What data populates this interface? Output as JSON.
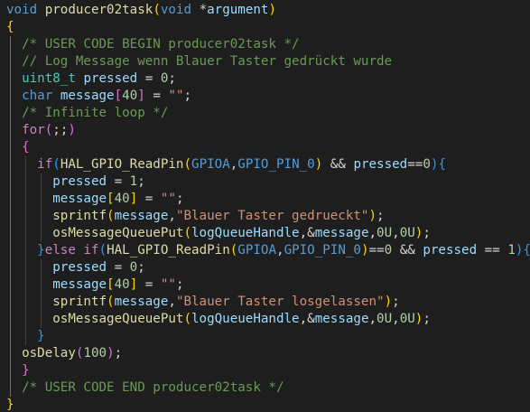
{
  "editor": {
    "language": "c",
    "colors": {
      "background": "#1e1e1e",
      "keyword": "#569cd6",
      "control": "#c586c0",
      "function": "#dcdcaa",
      "type": "#4ec9b0",
      "variable": "#9cdcfe",
      "string": "#ce9178",
      "number": "#b5cea8",
      "comment": "#6a9955",
      "text": "#d4d4d4",
      "bracket_level_1": "#ffd700",
      "bracket_level_2": "#da70d6",
      "bracket_level_3": "#179fff"
    },
    "lines": [
      [
        [
          "keyword",
          "void"
        ],
        [
          "plain",
          " "
        ],
        [
          "function",
          "producer02task"
        ],
        [
          "brace-y",
          "("
        ],
        [
          "keyword",
          "void"
        ],
        [
          "plain",
          " *"
        ],
        [
          "variable",
          "argument"
        ],
        [
          "brace-y",
          ")"
        ]
      ],
      [
        [
          "brace-y",
          "{"
        ]
      ],
      [
        [
          "plain",
          "  "
        ],
        [
          "comment",
          "/* USER CODE BEGIN producer02task */"
        ]
      ],
      [
        [
          "plain",
          "  "
        ],
        [
          "comment",
          "// Log Message wenn Blauer Taster gedrückt wurde"
        ]
      ],
      [
        [
          "plain",
          "  "
        ],
        [
          "type",
          "uint8_t"
        ],
        [
          "plain",
          " "
        ],
        [
          "variable",
          "pressed"
        ],
        [
          "plain",
          " = "
        ],
        [
          "number",
          "0"
        ],
        [
          "plain",
          ";"
        ]
      ],
      [
        [
          "plain",
          "  "
        ],
        [
          "keyword",
          "char"
        ],
        [
          "plain",
          " "
        ],
        [
          "variable",
          "message"
        ],
        [
          "brace-p",
          "["
        ],
        [
          "number",
          "40"
        ],
        [
          "brace-p",
          "]"
        ],
        [
          "plain",
          " = "
        ],
        [
          "string",
          "\"\""
        ],
        [
          "plain",
          ";"
        ]
      ],
      [
        [
          "plain",
          "  "
        ],
        [
          "comment",
          "/* Infinite loop */"
        ]
      ],
      [
        [
          "plain",
          "  "
        ],
        [
          "control",
          "for"
        ],
        [
          "brace-p",
          "("
        ],
        [
          "plain",
          ";;"
        ],
        [
          "brace-p",
          ")"
        ]
      ],
      [
        [
          "plain",
          "  "
        ],
        [
          "brace-p",
          "{"
        ]
      ],
      [
        [
          "plain",
          "    "
        ],
        [
          "control",
          "if"
        ],
        [
          "brace-b",
          "("
        ],
        [
          "function",
          "HAL_GPIO_ReadPin"
        ],
        [
          "brace-y",
          "("
        ],
        [
          "macro",
          "GPIOA"
        ],
        [
          "plain",
          ","
        ],
        [
          "macro",
          "GPIO_PIN_0"
        ],
        [
          "brace-y",
          ")"
        ],
        [
          "plain",
          " && "
        ],
        [
          "variable",
          "pressed"
        ],
        [
          "plain",
          "=="
        ],
        [
          "number",
          "0"
        ],
        [
          "brace-b",
          ")"
        ],
        [
          "brace-b",
          "{"
        ]
      ],
      [
        [
          "plain",
          "      "
        ],
        [
          "variable",
          "pressed"
        ],
        [
          "plain",
          " = "
        ],
        [
          "number",
          "1"
        ],
        [
          "plain",
          ";"
        ]
      ],
      [
        [
          "plain",
          "      "
        ],
        [
          "variable",
          "message"
        ],
        [
          "brace-y",
          "["
        ],
        [
          "number",
          "40"
        ],
        [
          "brace-y",
          "]"
        ],
        [
          "plain",
          " = "
        ],
        [
          "string",
          "\"\""
        ],
        [
          "plain",
          ";"
        ]
      ],
      [
        [
          "plain",
          "      "
        ],
        [
          "function",
          "sprintf"
        ],
        [
          "brace-y",
          "("
        ],
        [
          "variable",
          "message"
        ],
        [
          "plain",
          ","
        ],
        [
          "string",
          "\"Blauer Taster gedrueckt\""
        ],
        [
          "brace-y",
          ")"
        ],
        [
          "plain",
          ";"
        ]
      ],
      [
        [
          "plain",
          "      "
        ],
        [
          "function",
          "osMessageQueuePut"
        ],
        [
          "brace-y",
          "("
        ],
        [
          "variable",
          "logQueueHandle"
        ],
        [
          "plain",
          ",&"
        ],
        [
          "variable",
          "message"
        ],
        [
          "plain",
          ","
        ],
        [
          "number",
          "0U"
        ],
        [
          "plain",
          ","
        ],
        [
          "number",
          "0U"
        ],
        [
          "brace-y",
          ")"
        ],
        [
          "plain",
          ";"
        ]
      ],
      [
        [
          "plain",
          "    "
        ],
        [
          "brace-b",
          "}"
        ],
        [
          "control",
          "else"
        ],
        [
          "plain",
          " "
        ],
        [
          "control",
          "if"
        ],
        [
          "brace-b",
          "("
        ],
        [
          "function",
          "HAL_GPIO_ReadPin"
        ],
        [
          "brace-y",
          "("
        ],
        [
          "macro",
          "GPIOA"
        ],
        [
          "plain",
          ","
        ],
        [
          "macro",
          "GPIO_PIN_0"
        ],
        [
          "brace-y",
          ")"
        ],
        [
          "plain",
          "=="
        ],
        [
          "number",
          "0"
        ],
        [
          "plain",
          " && "
        ],
        [
          "variable",
          "pressed"
        ],
        [
          "plain",
          " == "
        ],
        [
          "number",
          "1"
        ],
        [
          "brace-b",
          ")"
        ],
        [
          "brace-b",
          "{"
        ]
      ],
      [
        [
          "plain",
          "      "
        ],
        [
          "variable",
          "pressed"
        ],
        [
          "plain",
          " = "
        ],
        [
          "number",
          "0"
        ],
        [
          "plain",
          ";"
        ]
      ],
      [
        [
          "plain",
          "      "
        ],
        [
          "variable",
          "message"
        ],
        [
          "brace-y",
          "["
        ],
        [
          "number",
          "40"
        ],
        [
          "brace-y",
          "]"
        ],
        [
          "plain",
          " = "
        ],
        [
          "string",
          "\"\""
        ],
        [
          "plain",
          ";"
        ]
      ],
      [
        [
          "plain",
          "      "
        ],
        [
          "function",
          "sprintf"
        ],
        [
          "brace-y",
          "("
        ],
        [
          "variable",
          "message"
        ],
        [
          "plain",
          ","
        ],
        [
          "string",
          "\"Blauer Taster losgelassen\""
        ],
        [
          "brace-y",
          ")"
        ],
        [
          "plain",
          ";"
        ]
      ],
      [
        [
          "plain",
          "      "
        ],
        [
          "function",
          "osMessageQueuePut"
        ],
        [
          "brace-y",
          "("
        ],
        [
          "variable",
          "logQueueHandle"
        ],
        [
          "plain",
          ",&"
        ],
        [
          "variable",
          "message"
        ],
        [
          "plain",
          ","
        ],
        [
          "number",
          "0U"
        ],
        [
          "plain",
          ","
        ],
        [
          "number",
          "0U"
        ],
        [
          "brace-y",
          ")"
        ],
        [
          "plain",
          ";"
        ]
      ],
      [
        [
          "plain",
          "    "
        ],
        [
          "brace-b",
          "}"
        ]
      ],
      [
        [
          "plain",
          "  "
        ],
        [
          "function",
          "osDelay"
        ],
        [
          "brace-p",
          "("
        ],
        [
          "number",
          "100"
        ],
        [
          "brace-p",
          ")"
        ],
        [
          "plain",
          ";"
        ]
      ],
      [
        [
          "plain",
          "  "
        ],
        [
          "brace-p",
          "}"
        ]
      ],
      [
        [
          "plain",
          "  "
        ],
        [
          "comment",
          "/* USER CODE END producer02task */"
        ]
      ],
      [
        [
          "brace-y",
          "}"
        ]
      ]
    ]
  }
}
